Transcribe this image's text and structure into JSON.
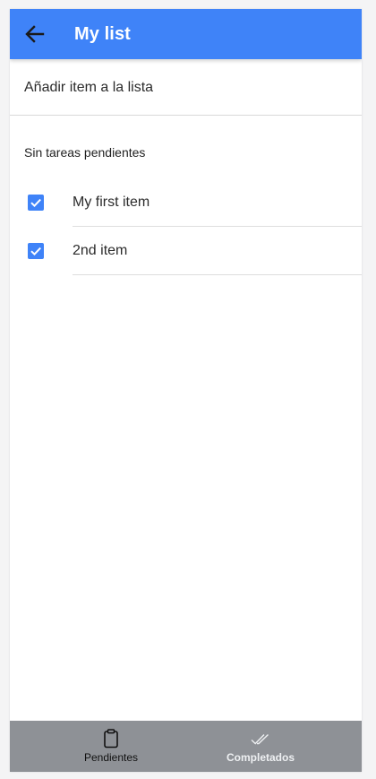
{
  "header": {
    "title": "My list",
    "back_icon": "arrow-left-icon",
    "background": "#3f83f8"
  },
  "add_item": {
    "placeholder": "Añadir item a la lista"
  },
  "section": {
    "label": "Sin tareas pendientes"
  },
  "items": [
    {
      "label": "My first item",
      "checked": true
    },
    {
      "label": "2nd item",
      "checked": true
    }
  ],
  "bottom_nav": {
    "background": "#8e9196",
    "tabs": [
      {
        "label": "Pendientes",
        "icon": "clipboard-icon",
        "active": false
      },
      {
        "label": "Completados",
        "icon": "double-check-icon",
        "active": true
      }
    ]
  }
}
